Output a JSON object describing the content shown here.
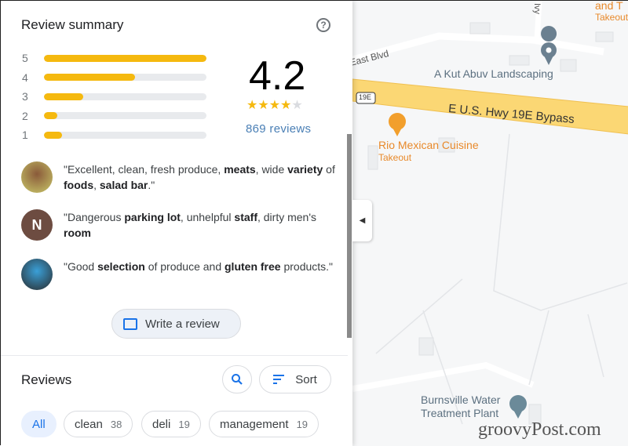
{
  "summary": {
    "title": "Review summary",
    "help_icon": "help-circle-icon",
    "rating": "4.2",
    "stars": "★★★★",
    "star_empty": "★",
    "reviews_link": "869 reviews",
    "distribution": [
      {
        "label": "5",
        "fraction": 1.0
      },
      {
        "label": "4",
        "fraction": 0.56
      },
      {
        "label": "3",
        "fraction": 0.24
      },
      {
        "label": "2",
        "fraction": 0.08
      },
      {
        "label": "1",
        "fraction": 0.11
      }
    ],
    "colors": {
      "bar": "#f5b90f",
      "link": "#4a7fb5"
    }
  },
  "snippets": [
    {
      "avatar": "photo",
      "parts": [
        [
          "\"Excellent, clean, fresh produce, ",
          0
        ],
        [
          "meats",
          1
        ],
        [
          ", wide ",
          0
        ],
        [
          "variety",
          1
        ],
        [
          " of ",
          0
        ],
        [
          "foods",
          1
        ],
        [
          ", ",
          0
        ],
        [
          "salad bar",
          1
        ],
        [
          ".\"",
          0
        ]
      ]
    },
    {
      "avatar": "N",
      "avatar_color": "#6d4c41",
      "parts": [
        [
          "\"Dangerous ",
          0
        ],
        [
          "parking lot",
          1
        ],
        [
          ", unhelpful ",
          0
        ],
        [
          "staff",
          1
        ],
        [
          ", dirty men's ",
          0
        ],
        [
          "room",
          1
        ]
      ]
    },
    {
      "avatar": "photo",
      "parts": [
        [
          "\"Good ",
          0
        ],
        [
          "selection",
          1
        ],
        [
          " of produce and ",
          0
        ],
        [
          "gluten free",
          1
        ],
        [
          " products.\"",
          0
        ]
      ]
    }
  ],
  "write_review": "Write a review",
  "reviews": {
    "title": "Reviews",
    "sort_label": "Sort",
    "chips": [
      {
        "label": "All",
        "count": ""
      },
      {
        "label": "clean",
        "count": "38"
      },
      {
        "label": "deli",
        "count": "19"
      },
      {
        "label": "management",
        "count": "19"
      }
    ]
  },
  "map": {
    "labels": {
      "top_place": "and T",
      "top_place_sub": "Takeout",
      "street1": "East Blvd",
      "street2": "Ivy",
      "place1": "A Kut Abuv Landscaping",
      "highway": "E U.S. Hwy 19E Bypass",
      "shield": "19E",
      "place2": "Rio Mexican Cuisine",
      "place2_sub": "Takeout",
      "place3_line1": "Burnsville Water",
      "place3_line2": "Treatment Plant"
    }
  },
  "watermark": "groovyPost.com"
}
